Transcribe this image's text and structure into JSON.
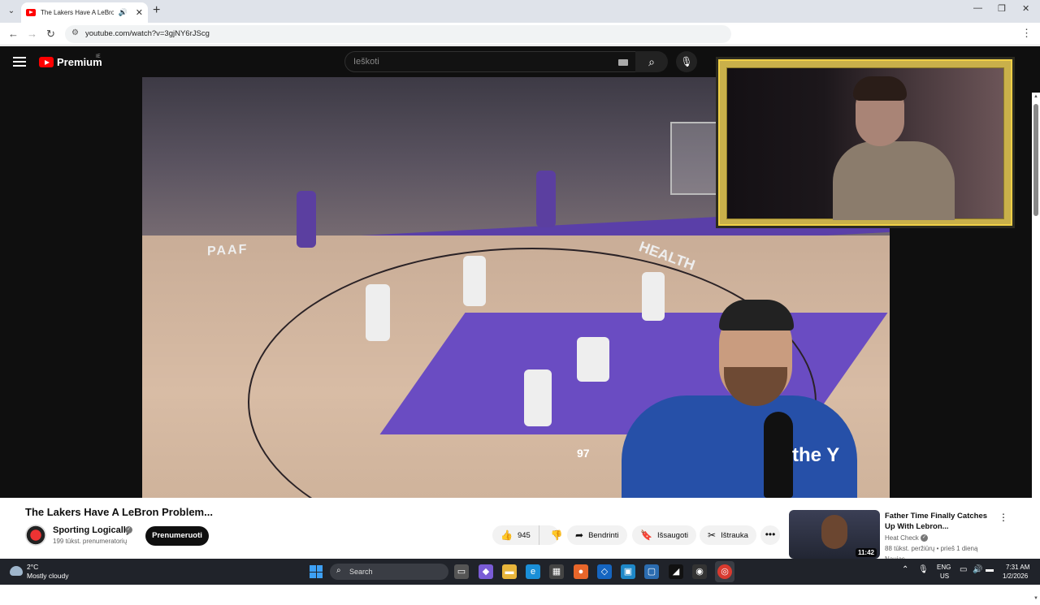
{
  "browser": {
    "tab_title": "The Lakers Have A LeBron Problem...",
    "url": "youtube.com/watch?v=3gjNY6rJScg"
  },
  "youtube": {
    "logo_text": "Premium",
    "country_code": "IE",
    "search_placeholder": "Ieškoti"
  },
  "video": {
    "title": "The Lakers Have A LeBron Problem...",
    "channel": "Sporting Logically",
    "subscribers": "199 tūkst. prenumeratorių",
    "subscribe_label": "Prenumeruoti",
    "like_count": "945",
    "share_label": "Bendrinti",
    "save_label": "Išsaugoti",
    "clip_label": "Ištrauka",
    "overlay_court_text": "PAAF",
    "overlay_court_text2": "HEALTH",
    "referee_number": "97",
    "presenter_shirt_logo": "the Y"
  },
  "recommendation": {
    "title": "Father Time Finally Catches Up With Lebron...",
    "channel": "Heat Check",
    "meta": "88 tūkst. peržiūrų • prieš 1 dieną",
    "extra": "Naujas",
    "duration": "11:42"
  },
  "taskbar": {
    "temperature": "2°C",
    "condition": "Mostly cloudy",
    "search_label": "Search",
    "lang_line1": "ENG",
    "lang_line2": "US",
    "time": "7:31 AM",
    "date": "1/2/2026"
  },
  "colors": {
    "youtube_bg": "#0f0f0f",
    "youtube_red": "#ff0000",
    "webcam_border": "#f0d047",
    "taskbar_bg": "#20232a"
  }
}
